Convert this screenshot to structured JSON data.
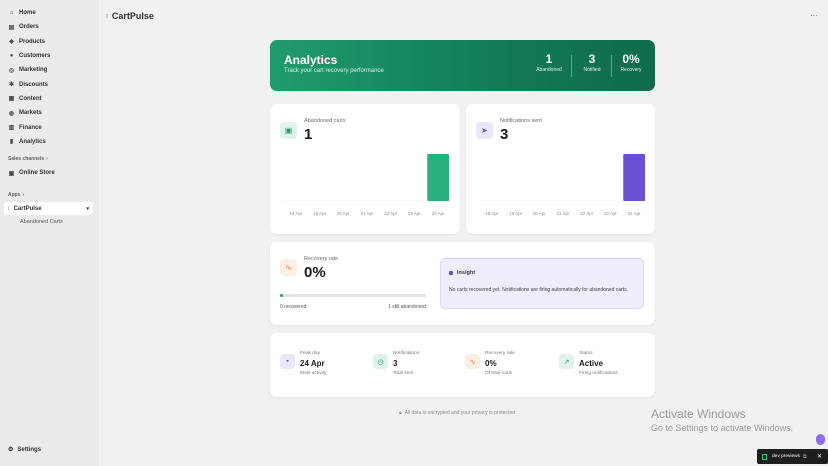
{
  "sidebar": {
    "items": [
      {
        "label": "Home",
        "icon": "home-icon"
      },
      {
        "label": "Orders",
        "icon": "inbox-icon"
      },
      {
        "label": "Products",
        "icon": "tag-icon"
      },
      {
        "label": "Customers",
        "icon": "person-icon"
      },
      {
        "label": "Marketing",
        "icon": "target-icon"
      },
      {
        "label": "Discounts",
        "icon": "discount-icon"
      },
      {
        "label": "Content",
        "icon": "content-icon"
      },
      {
        "label": "Markets",
        "icon": "globe-icon"
      },
      {
        "label": "Finance",
        "icon": "bank-icon"
      },
      {
        "label": "Analytics",
        "icon": "chart-icon"
      }
    ],
    "sales_channels_label": "Sales channels",
    "online_store_label": "Online Store",
    "apps_label": "Apps",
    "app_name": "CartPulse",
    "app_sub_item": "Abandoned Carts",
    "settings_label": "Settings"
  },
  "topbar": {
    "title": "CartPulse"
  },
  "hero": {
    "title": "Analytics",
    "subtitle": "Track your cart recovery performance",
    "stats": [
      {
        "value": "1",
        "label": "Abandoned"
      },
      {
        "value": "3",
        "label": "Notified"
      },
      {
        "value": "0%",
        "label": "Recovery"
      }
    ]
  },
  "abandoned_card": {
    "label": "Abandoned carts",
    "value": "1",
    "color": "#2bb07d"
  },
  "notifications_card": {
    "label": "Notifications sent",
    "value": "3",
    "color": "#6a4fd0"
  },
  "chart_data": [
    {
      "type": "bar",
      "categories": [
        "18 Apr",
        "19 Apr",
        "20 Apr",
        "21 Apr",
        "22 Apr",
        "23 Apr",
        "24 Apr"
      ],
      "values": [
        0,
        0,
        0,
        0,
        0,
        0,
        1
      ]
    },
    {
      "type": "bar",
      "categories": [
        "18 Apr",
        "19 Apr",
        "20 Apr",
        "21 Apr",
        "22 Apr",
        "23 Apr",
        "24 Apr"
      ],
      "values": [
        0,
        0,
        0,
        0,
        0,
        0,
        3
      ]
    }
  ],
  "recovery": {
    "label": "Recovery rate",
    "value": "0%",
    "progress": 0.02,
    "recovered_text": "0 recovered",
    "abandoned_text": "1 still abandoned"
  },
  "insight": {
    "title": "Insight",
    "text": "No carts recovered yet. Notifications are firing automatically for abandoned carts."
  },
  "summary": [
    {
      "label": "Peak day",
      "value": "24 Apr",
      "sub": "Most activity",
      "icon": "calendar-icon"
    },
    {
      "label": "Notifications",
      "value": "3",
      "sub": "Total sent",
      "icon": "clock-icon"
    },
    {
      "label": "Recovery rate",
      "value": "0%",
      "sub": "Of total carts",
      "icon": "pulse-icon"
    },
    {
      "label": "Status",
      "value": "Active",
      "sub": "Firing notifications",
      "icon": "trend-icon"
    }
  ],
  "footer_note": "All data is encrypted and your privacy is protected",
  "watermark": {
    "line1": "Activate Windows",
    "line2": "Go to Settings to activate Windows."
  },
  "toast": {
    "text": "dev previews"
  }
}
